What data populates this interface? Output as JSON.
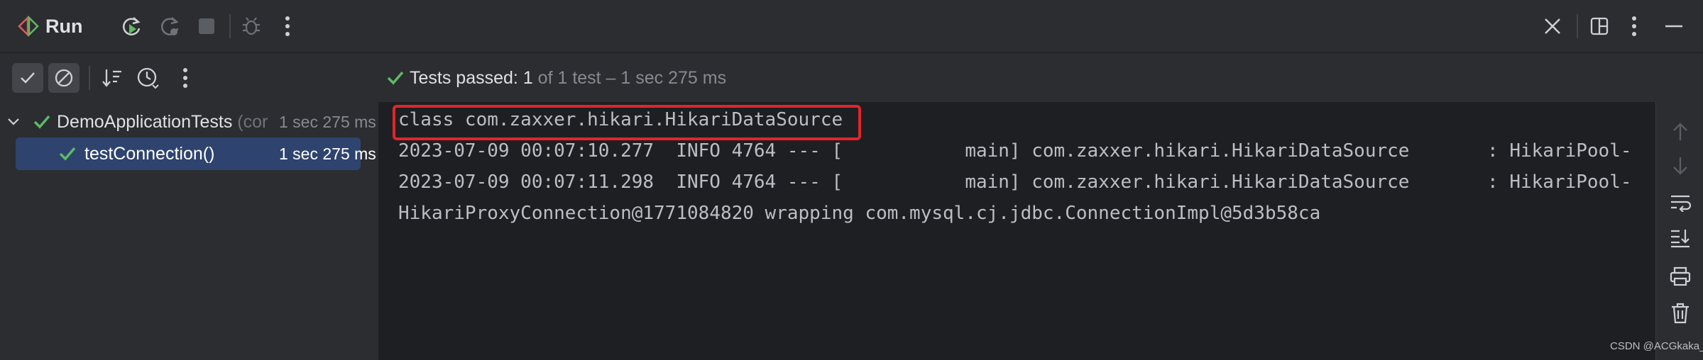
{
  "toolbar": {
    "title": "Run"
  },
  "subbar": {
    "status_prefix": "Tests passed:",
    "status_count": "1",
    "status_suffix": "of 1 test – 1 sec 275 ms"
  },
  "tree": {
    "root": {
      "label": "DemoApplicationTests",
      "suffix": "(cor",
      "time": "1 sec 275 ms"
    },
    "child": {
      "label": "testConnection()",
      "time": "1 sec 275 ms"
    }
  },
  "console": {
    "lines": [
      "class com.zaxxer.hikari.HikariDataSource",
      "2023-07-09 00:07:10.277  INFO 4764 --- [           main] com.zaxxer.hikari.HikariDataSource       : HikariPool-",
      "2023-07-09 00:07:11.298  INFO 4764 --- [           main] com.zaxxer.hikari.HikariDataSource       : HikariPool-",
      "HikariProxyConnection@1771084820 wrapping com.mysql.cj.jdbc.ConnectionImpl@5d3b58ca"
    ],
    "highlight_color": "#e0262b"
  },
  "watermark": "CSDN @ACGkaka_",
  "colors": {
    "pass_green": "#5fb865",
    "selection": "#2e436e",
    "accent": "#3574f0"
  }
}
